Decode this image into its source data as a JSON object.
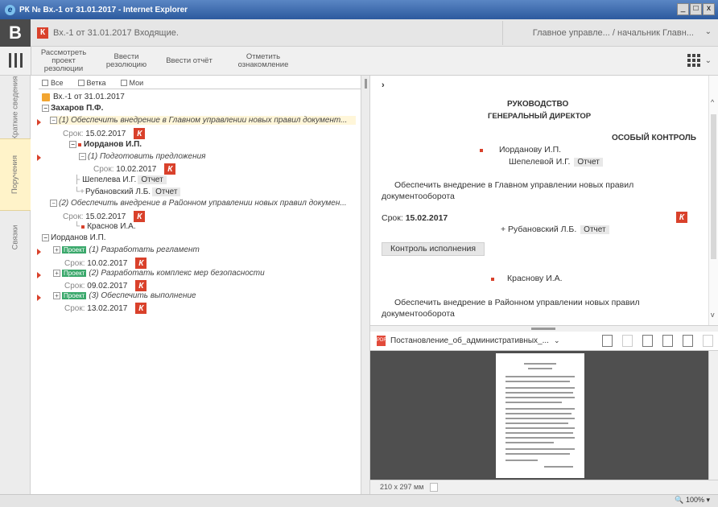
{
  "window": {
    "title": "РК № Вх.-1 от 31.01.2017 - Internet Explorer",
    "min": "_",
    "max": "□",
    "close": "x"
  },
  "header": {
    "logo": "В",
    "k_badge": "К",
    "title": "Вх.-1 от 31.01.2017  Входящие.",
    "user": "Главное управле... / начальник Главн..."
  },
  "toolbar": {
    "btn_review": "Рассмотреть проект резолюции",
    "btn_enter_resolution": "Ввести резолюцию",
    "btn_enter_report": "Ввести отчёт",
    "btn_mark_ack": "Отметить ознакомление"
  },
  "tabs": {
    "brief": "Краткие сведения",
    "orders": "Поручения",
    "links": "Связки"
  },
  "tree": {
    "filter_all": "Все",
    "filter_branch": "Ветка",
    "filter_mine": "Мои",
    "root": "Вх.-1 от 31.01.2017",
    "n1_name": "Захаров П.Ф.",
    "n1_item1": "(1) Обеспечить внедрение в Главном управлении новых правил документ...",
    "due_label": "Срок:",
    "n1_item1_due": "15.02.2017",
    "n2_name": "Иорданов И.П.",
    "n2_item1": "(1) Подготовить предложения",
    "n2_item1_due": "10.02.2017",
    "p_shepeleva": "Шепелева И.Г.",
    "p_rubanovsky": "Рубановский Л.Б.",
    "otchet": "Отчет",
    "n1_item2": "(2) Обеспечить внедрение в Районном управлении новых правил докумен...",
    "n1_item2_due": "15.02.2017",
    "p_krasnov": "Краснов И.А.",
    "n3_name": "Иорданов И.П.",
    "proj_label": "Проект",
    "proj1": "(1) Разработать регламент",
    "proj1_due": "10.02.2017",
    "proj2": "(2) Разработать комплекс мер безопасности",
    "proj2_due": "09.02.2017",
    "proj3": "(3) Обеспечить выполнение",
    "proj3_due": "13.02.2017"
  },
  "doc": {
    "head1": "РУКОВОДСТВО",
    "head2": "ГЕНЕРАЛЬНЫЙ ДИРЕКТОР",
    "special": "ОСОБЫЙ КОНТРОЛЬ",
    "addr1": "Иорданову И.П.",
    "addr2": "Шепелевой И.Г.",
    "otchet": "Отчет",
    "text1a": "Обеспечить внедрение в Главном управлении новых правил",
    "text1b": "документооборота",
    "due_label": "Срок:",
    "due_value": "15.02.2017",
    "rubanovsky": "+ Рубановский Л.Б.",
    "control_btn": "Контроль исполнения",
    "krasnovu": "Краснову И.А.",
    "text2a": "Обеспечить внедрение в Районном управлении новых правил",
    "text2b": "документооборота"
  },
  "attachments": {
    "file_name": "Постановление_об_административных_...",
    "page_size": "210 x 297 мм"
  },
  "status": {
    "zoom": "100%"
  },
  "colors": {
    "accent_red": "#d9412b",
    "project_green": "#3aa86b",
    "highlight_tab": "#fff3c9",
    "title_bar": "#2c5a9e"
  }
}
